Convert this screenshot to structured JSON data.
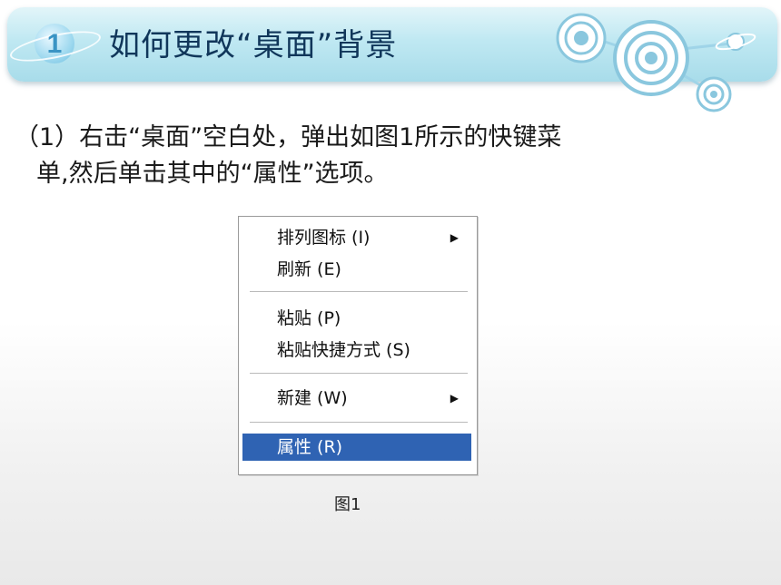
{
  "header": {
    "number": "1",
    "title": "如何更改“桌面”背景"
  },
  "instruction": {
    "line1": "（1）右击“桌面”空白处，弹出如图1所示的快键菜",
    "line2": "单,然后单击其中的“属性”选项。"
  },
  "context_menu": {
    "items": [
      {
        "label": "排列图标 (I)",
        "has_submenu": true
      },
      {
        "label": "刷新 (E)",
        "has_submenu": false
      },
      {
        "label": "粘贴 (P)",
        "has_submenu": false
      },
      {
        "label": "粘贴快捷方式 (S)",
        "has_submenu": false
      },
      {
        "label": "新建 (W)",
        "has_submenu": true
      },
      {
        "label": "属性 (R)",
        "has_submenu": false,
        "selected": true
      }
    ],
    "submenu_arrow": "▶",
    "highlight_color": "#2f63b3"
  },
  "figure_caption": "图1"
}
